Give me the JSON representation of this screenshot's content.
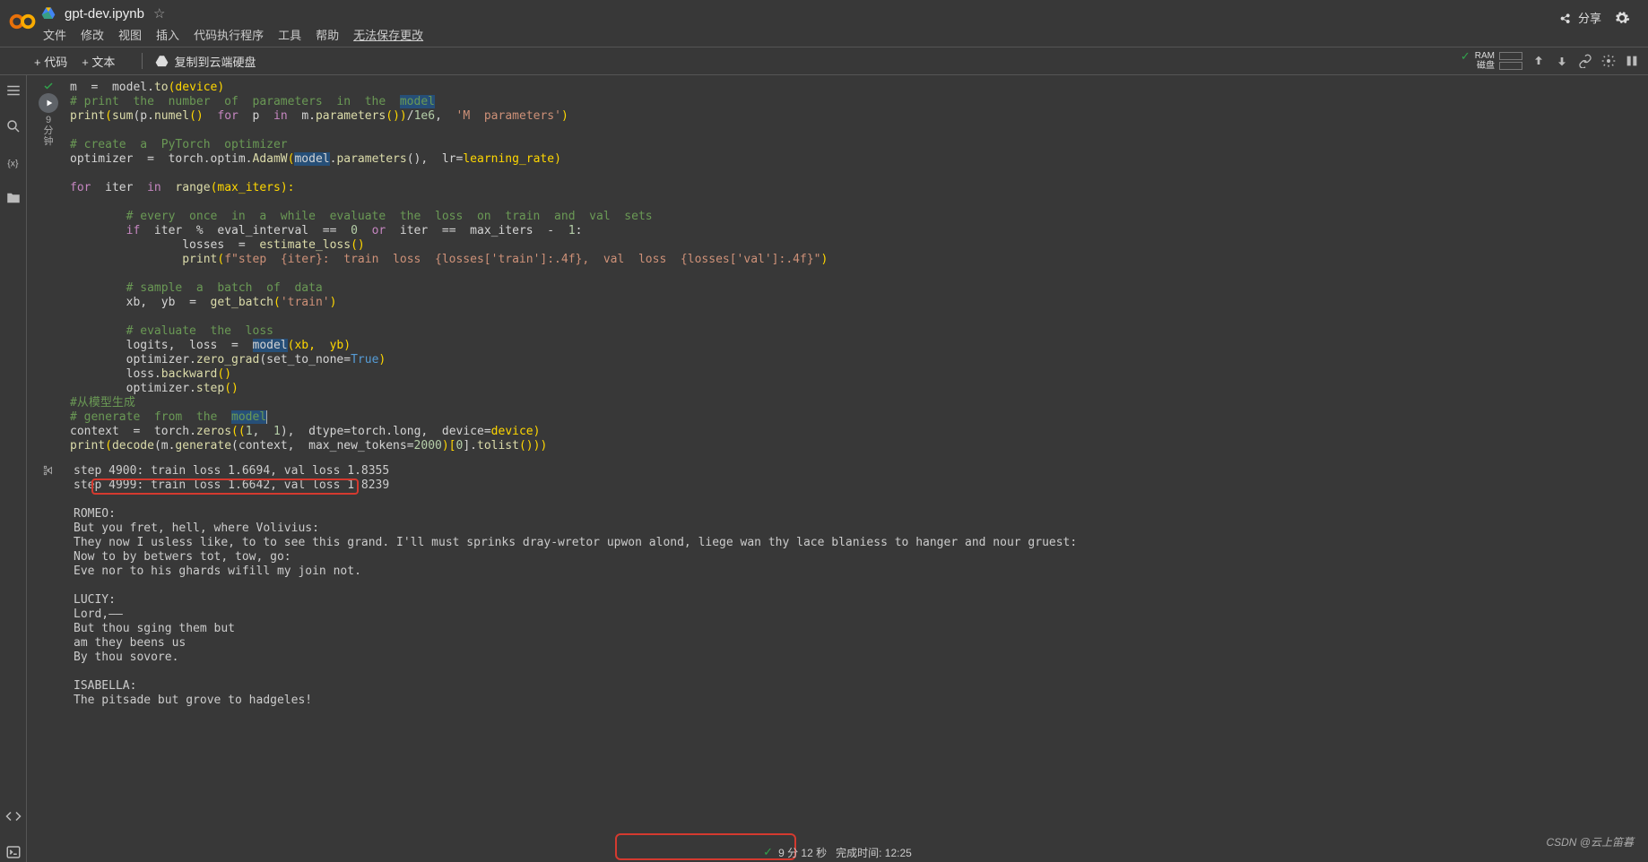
{
  "header": {
    "filename": "gpt-dev.ipynb",
    "menus": [
      "文件",
      "修改",
      "视图",
      "插入",
      "代码执行程序",
      "工具",
      "帮助"
    ],
    "save_msg": "无法保存更改",
    "share": "分享"
  },
  "toolbar": {
    "code": "+ 代码",
    "text": "+ 文本",
    "copy": "复制到云端硬盘",
    "ram": "RAM",
    "disk": "磁盘"
  },
  "gutter": {
    "exec_l1": "9",
    "exec_l2": "分",
    "exec_l3": "钟"
  },
  "code": {
    "l1a": "m  ",
    "l1b": "=",
    "l1c": "  model.",
    "l1d": "to",
    "l1e": "(device)",
    "l2": "# print  the  number  of  parameters  in  the  ",
    "l2b": "model",
    "l3a": "print",
    "l3b": "(",
    "l3c": "sum",
    "l3d": "(p.",
    "l3e": "numel",
    "l3f": "()  ",
    "l3g": "for",
    "l3h": "  p  ",
    "l3i": "in",
    "l3j": "  m.",
    "l3k": "parameters",
    "l3l": "())",
    "l3m": "/",
    "l3n": "1e6",
    "l3o": ",  ",
    "l3p": "'M  parameters'",
    "l3q": ")",
    "l5": "# create  a  PyTorch  optimizer",
    "l6a": "optimizer  ",
    "l6b": "=",
    "l6c": "  torch.optim.",
    "l6d": "AdamW",
    "l6e": "(",
    "l6f": "model",
    "l6g": ".",
    "l6h": "parameters",
    "l6i": "(),  lr",
    "l6j": "=",
    "l6k": "learning_rate)",
    "l8a": "for",
    "l8b": "  iter  ",
    "l8c": "in",
    "l8d": "  ",
    "l8e": "range",
    "l8f": "(max_iters):",
    "l10": "        # every  once  in  a  while  evaluate  the  loss  on  train  and  val  sets",
    "l11a": "        ",
    "l11b": "if",
    "l11c": "  iter  ",
    "l11d": "%",
    "l11e": "  eval_interval  ",
    "l11f": "==",
    "l11g": "  ",
    "l11h": "0",
    "l11i": "  ",
    "l11j": "or",
    "l11k": "  iter  ",
    "l11l": "==",
    "l11m": "  max_iters  ",
    "l11n": "-",
    "l11o": "  ",
    "l11p": "1",
    "l11q": ":",
    "l12a": "                losses  ",
    "l12b": "=",
    "l12c": "  ",
    "l12d": "estimate_loss",
    "l12e": "()",
    "l13a": "                ",
    "l13b": "print",
    "l13c": "(",
    "l13d": "f\"step  {iter}:  train  loss  {losses['train']:.4f},  val  loss  {losses['val']:.4f}\"",
    "l13e": ")",
    "l15": "        # sample  a  batch  of  data",
    "l16a": "        xb,  yb  ",
    "l16b": "=",
    "l16c": "  ",
    "l16d": "get_batch",
    "l16e": "(",
    "l16f": "'train'",
    "l16g": ")",
    "l18": "        # evaluate  the  loss",
    "l19a": "        logits,  loss  ",
    "l19b": "=",
    "l19c": "  ",
    "l19d": "model",
    "l19e": "(xb,  yb)",
    "l20a": "        optimizer.",
    "l20b": "zero_grad",
    "l20c": "(set_to_none",
    "l20d": "=",
    "l20e": "True",
    "l20f": ")",
    "l21a": "        loss.",
    "l21b": "backward",
    "l21c": "()",
    "l22a": "        optimizer.",
    "l22b": "step",
    "l22c": "()",
    "l23": "#从模型生成",
    "l24": "# generate  from  the  ",
    "l24b": "model",
    "l25a": "context  ",
    "l25b": "=",
    "l25c": "  torch.",
    "l25d": "zeros",
    "l25e": "((",
    "l25f": "1",
    "l25g": ",  ",
    "l25h": "1",
    "l25i": "),  dtype",
    "l25j": "=",
    "l25k": "torch.long,  device",
    "l25l": "=",
    "l25m": "device)",
    "l26a": "print",
    "l26b": "(",
    "l26c": "decode",
    "l26d": "(m.",
    "l26e": "generate",
    "l26f": "(context,  max_new_tokens",
    "l26g": "=",
    "l26h": "2000",
    "l26i": ")[",
    "l26j": "0",
    "l26k": "].",
    "l26l": "tolist",
    "l26m": "()))"
  },
  "output": "step 4900: train loss 1.6694, val loss 1.8355\nstep 4999: train loss 1.6642, val loss 1.8239\n\nROMEO:\nBut you fret, hell, where Volivius:\nThey now I usless like, to to see this grand. I'll must sprinks dray-wretor upwon alond, liege wan thy lace blaniess to hanger and nour gruest:\nNow to by betwers tot, tow, go:\nEve nor to his ghards wifill my join not.\n\nLUCIY:\nLord,——\nBut thou sging them but\nam they beens us\nBy thou sovore.\n\nISABELLA:\nThe pitsade but grove to hadgeles!",
  "status": {
    "time": "9 分 12 秒",
    "done": "完成时间: 12:25"
  },
  "watermark": "CSDN @云上笛暮"
}
